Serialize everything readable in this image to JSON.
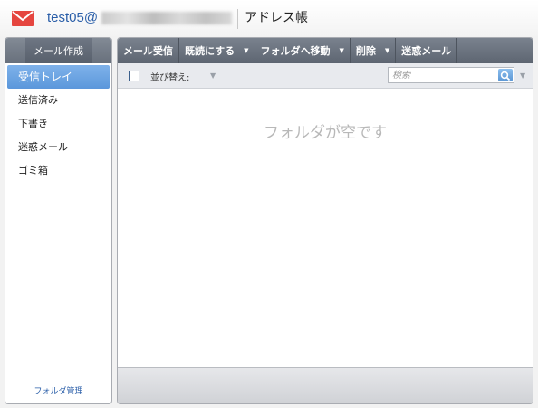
{
  "header": {
    "account_prefix": "test05@",
    "address_book": "アドレス帳"
  },
  "sidebar": {
    "compose_label": "メール作成",
    "folders": [
      {
        "label": "受信トレイ"
      },
      {
        "label": "送信済み"
      },
      {
        "label": "下書き"
      },
      {
        "label": "迷惑メール"
      },
      {
        "label": "ゴミ箱"
      }
    ],
    "folder_manage": "フォルダ管理"
  },
  "toolbar": {
    "receive": "メール受信",
    "mark_read": "既読にする",
    "move_folder": "フォルダへ移動",
    "delete": "削除",
    "spam": "迷惑メール"
  },
  "subbar": {
    "sort_label": "並び替え:",
    "search_placeholder": "検索"
  },
  "content": {
    "empty_message": "フォルダが空です"
  },
  "colors": {
    "accent_blue": "#5b97db",
    "toolbar_gray": "#68707c",
    "mail_icon_red": "#e5453f"
  }
}
